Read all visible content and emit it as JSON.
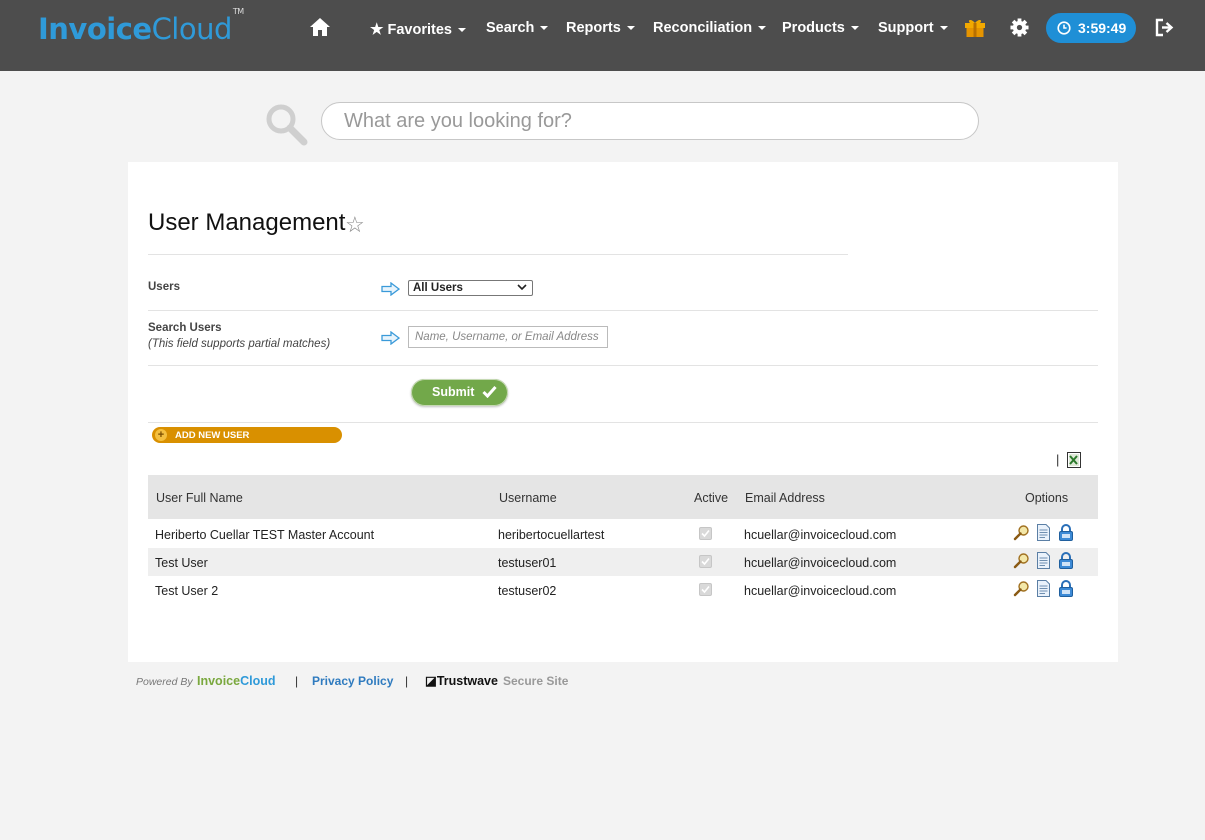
{
  "header": {
    "logo_part1": "Invoice",
    "logo_part2": "Cloud",
    "logo_tm": "TM",
    "nav": [
      {
        "label": "Favorites"
      },
      {
        "label": "Search"
      },
      {
        "label": "Reports"
      },
      {
        "label": "Reconciliation"
      },
      {
        "label": "Products"
      },
      {
        "label": "Support"
      }
    ],
    "timer": "3:59:49",
    "icons": [
      "home-icon",
      "star-icon",
      "gift-icon",
      "gear-icon",
      "clock-icon",
      "logout-icon"
    ]
  },
  "search": {
    "placeholder": "What are you looking for?"
  },
  "page": {
    "title": "User Management",
    "users_label": "Users",
    "users_select_value": "All Users",
    "search_users_label": "Search Users",
    "search_users_hint": "(This field supports partial matches)",
    "search_users_placeholder": "Name, Username, or Email Address",
    "submit_label": "Submit",
    "add_new_user_label": "ADD NEW USER",
    "export_separator": "|"
  },
  "table": {
    "columns": [
      "User Full Name",
      "Username",
      "Active",
      "Email Address",
      "Options"
    ],
    "rows": [
      {
        "full_name": "Heriberto Cuellar TEST Master Account",
        "username": "heribertocuellartest",
        "active": true,
        "email": "hcuellar@invoicecloud.com"
      },
      {
        "full_name": "Test User",
        "username": "testuser01",
        "active": true,
        "email": "hcuellar@invoicecloud.com"
      },
      {
        "full_name": "Test User 2",
        "username": "testuser02",
        "active": true,
        "email": "hcuellar@invoicecloud.com"
      }
    ],
    "option_icons": [
      "view-icon",
      "document-icon",
      "lock-icon"
    ]
  },
  "footer": {
    "powered_by": "Powered By",
    "logo_part1": "Invoice",
    "logo_part2": "Cloud",
    "sep": "|",
    "privacy": "Privacy Policy",
    "trustwave": "Trustwave",
    "secure_site": "Secure Site"
  },
  "colors": {
    "topbar": "#4d4d4d",
    "brand_blue": "#2f9ad9",
    "timer_blue": "#1f8fd6",
    "submit_green": "#72a84a",
    "add_orange": "#d99000",
    "link_blue": "#2f7bbf"
  }
}
